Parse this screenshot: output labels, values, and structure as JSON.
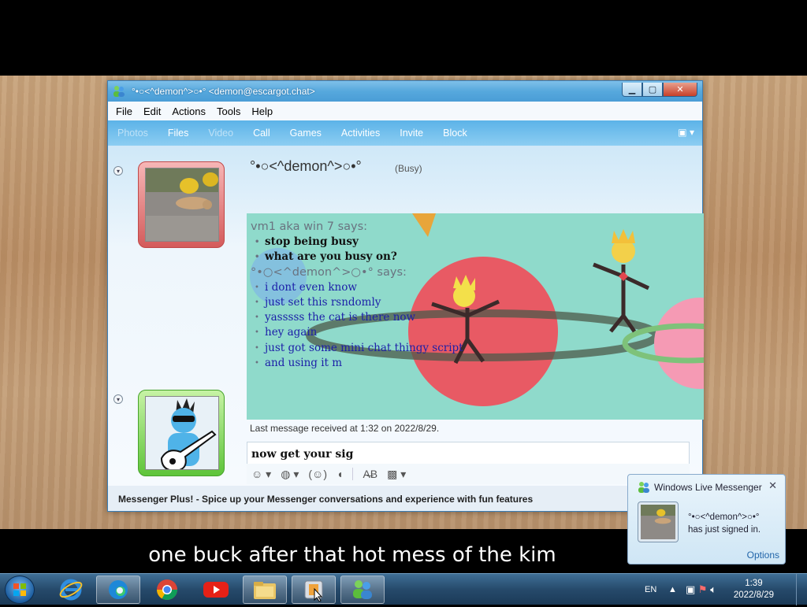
{
  "window": {
    "title": "°•○<^demon^>○•° <demon@escargot.chat>",
    "buttons": {
      "minimize": "▁",
      "maximize": "▢",
      "close": "✕"
    }
  },
  "menu": [
    "File",
    "Edit",
    "Actions",
    "Tools",
    "Help"
  ],
  "toolbar": [
    {
      "label": "Photos",
      "enabled": false
    },
    {
      "label": "Files",
      "enabled": true
    },
    {
      "label": "Video",
      "enabled": false
    },
    {
      "label": "Call",
      "enabled": true
    },
    {
      "label": "Games",
      "enabled": true
    },
    {
      "label": "Activities",
      "enabled": true
    },
    {
      "label": "Invite",
      "enabled": true
    },
    {
      "label": "Block",
      "enabled": true
    }
  ],
  "contact": {
    "name": "°•○<^demon^>○•°",
    "status": "(Busy)"
  },
  "chat": {
    "blocks": [
      {
        "sender": "vm1 aka win 7 says:",
        "style": "bold",
        "lines": [
          "stop being busy",
          "what are you busy on?"
        ]
      },
      {
        "sender": "°•○<^demon^>○•° says:",
        "style": "blue",
        "lines": [
          "i dont even know",
          "just set this rsndomly",
          "yasssss the cat is there now",
          "hey again",
          "just got some mini chat thingy script",
          "and using it m"
        ]
      }
    ],
    "last_message": "Last message received at 1:32 on 2022/8/29.",
    "input_value": "now get your sig"
  },
  "statusbar": "Messenger Plus! - Spice up your Messenger conversations and experience with fun features",
  "notification": {
    "app": "Windows Live Messenger",
    "close": "✕",
    "name": "°•○<^demon^>○•°",
    "message": "has just signed in.",
    "options": "Options"
  },
  "subtitle": "one buck after that hot mess of the kim",
  "tray": {
    "language": "EN",
    "time": "1:39",
    "date": "2022/8/29"
  },
  "colors": {
    "titlebar": "#56a8dd",
    "history_bg": "#8fdacb",
    "sender_text": "#1c1fa8"
  }
}
